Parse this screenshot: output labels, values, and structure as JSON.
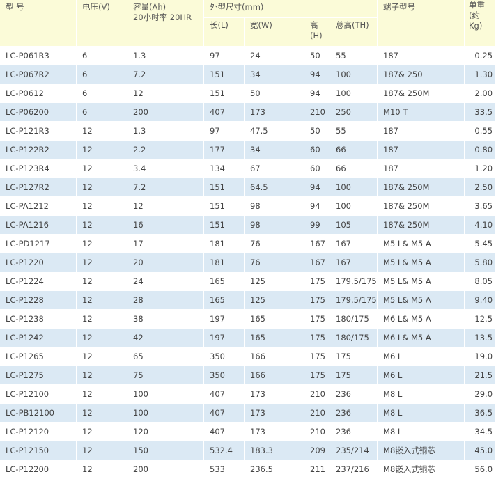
{
  "headers": {
    "model": "型  号",
    "voltage": "电压(V)",
    "capacity": "容量(Ah)",
    "capacity_sub": "20小时率 20HR",
    "dimensions": "外型尺寸(mm)",
    "length": "长(L)",
    "width": "宽(W)",
    "height_line1": "高",
    "height_line2": "(H)",
    "total_height": "总高(TH)",
    "terminal": "端子型号",
    "weight_line1": "单重",
    "weight_line2": "(约",
    "weight_line3": "Kg)"
  },
  "rows": [
    {
      "model": "LC-P061R3",
      "voltage": "6",
      "capacity": "1.3",
      "length": "97",
      "width": "24",
      "height": "50",
      "total_height": "55",
      "terminal": "187",
      "weight": "0.25"
    },
    {
      "model": "LC-P067R2",
      "voltage": "6",
      "capacity": "7.2",
      "length": "151",
      "width": "34",
      "height": "94",
      "total_height": "100",
      "terminal": "187& 250",
      "weight": "1.30"
    },
    {
      "model": "LC-P0612",
      "voltage": "6",
      "capacity": "12",
      "length": "151",
      "width": "50",
      "height": "94",
      "total_height": "100",
      "terminal": "187& 250M",
      "weight": "2.00"
    },
    {
      "model": "LC-P06200",
      "voltage": "6",
      "capacity": "200",
      "length": "407",
      "width": "173",
      "height": "210",
      "total_height": "250",
      "terminal": "M10 T",
      "weight": "33.5"
    },
    {
      "model": "LC-P121R3",
      "voltage": "12",
      "capacity": "1.3",
      "length": "97",
      "width": "47.5",
      "height": "50",
      "total_height": "55",
      "terminal": "187",
      "weight": "0.55"
    },
    {
      "model": "LC-P122R2",
      "voltage": "12",
      "capacity": "2.2",
      "length": "177",
      "width": "34",
      "height": "60",
      "total_height": "66",
      "terminal": "187",
      "weight": "0.80"
    },
    {
      "model": "LC-P123R4",
      "voltage": "12",
      "capacity": "3.4",
      "length": "134",
      "width": "67",
      "height": "60",
      "total_height": "66",
      "terminal": "187",
      "weight": "1.20"
    },
    {
      "model": "LC-P127R2",
      "voltage": "12",
      "capacity": "7.2",
      "length": "151",
      "width": "64.5",
      "height": "94",
      "total_height": "100",
      "terminal": "187& 250M",
      "weight": "2.50"
    },
    {
      "model": "LC-PA1212",
      "voltage": "12",
      "capacity": "12",
      "length": "151",
      "width": "98",
      "height": "94",
      "total_height": "100",
      "terminal": "187& 250M",
      "weight": "3.65"
    },
    {
      "model": "LC-PA1216",
      "voltage": "12",
      "capacity": "16",
      "length": "151",
      "width": "98",
      "height": "99",
      "total_height": "105",
      "terminal": "187& 250M",
      "weight": "4.10"
    },
    {
      "model": "LC-PD1217",
      "voltage": "12",
      "capacity": "17",
      "length": "181",
      "width": "76",
      "height": "167",
      "total_height": "167",
      "terminal": "M5 L& M5 A",
      "weight": "5.45"
    },
    {
      "model": "LC-P1220",
      "voltage": "12",
      "capacity": "20",
      "length": "181",
      "width": "76",
      "height": "167",
      "total_height": "167",
      "terminal": "M5 L& M5 A",
      "weight": "5.80"
    },
    {
      "model": "LC-P1224",
      "voltage": "12",
      "capacity": "24",
      "length": "165",
      "width": "125",
      "height": "175",
      "total_height": "179.5/175",
      "terminal": "M5 L& M5 A",
      "weight": "8.05"
    },
    {
      "model": "LC-P1228",
      "voltage": "12",
      "capacity": "28",
      "length": "165",
      "width": "125",
      "height": "175",
      "total_height": "179.5/175",
      "terminal": "M5 L& M5 A",
      "weight": "9.40"
    },
    {
      "model": "LC-P1238",
      "voltage": "12",
      "capacity": "38",
      "length": "197",
      "width": "165",
      "height": "175",
      "total_height": "180/175",
      "terminal": "M6 L& M5 A",
      "weight": "12.5"
    },
    {
      "model": "LC-P1242",
      "voltage": "12",
      "capacity": "42",
      "length": "197",
      "width": "165",
      "height": "175",
      "total_height": "180/175",
      "terminal": "M6 L& M5 A",
      "weight": "13.5"
    },
    {
      "model": "LC-P1265",
      "voltage": "12",
      "capacity": "65",
      "length": "350",
      "width": "166",
      "height": "175",
      "total_height": "175",
      "terminal": "M6 L",
      "weight": "19.0"
    },
    {
      "model": "LC-P1275",
      "voltage": "12",
      "capacity": "75",
      "length": "350",
      "width": "166",
      "height": "175",
      "total_height": "175",
      "terminal": "M6 L",
      "weight": "21.5"
    },
    {
      "model": "LC-P12100",
      "voltage": "12",
      "capacity": "100",
      "length": "407",
      "width": "173",
      "height": "210",
      "total_height": "236",
      "terminal": "M8 L",
      "weight": "29.0"
    },
    {
      "model": "LC-PB12100",
      "voltage": "12",
      "capacity": "100",
      "length": "407",
      "width": "173",
      "height": "210",
      "total_height": "236",
      "terminal": "M8 L",
      "weight": "36.5"
    },
    {
      "model": "LC-P12120",
      "voltage": "12",
      "capacity": "120",
      "length": "407",
      "width": "173",
      "height": "210",
      "total_height": "236",
      "terminal": "M8 L",
      "weight": "34.5"
    },
    {
      "model": "LC-P12150",
      "voltage": "12",
      "capacity": "150",
      "length": "532.4",
      "width": "183.3",
      "height": "209",
      "total_height": "235/214",
      "terminal": "M8嵌入式铜芯",
      "weight": "45.0"
    },
    {
      "model": "LC-P12200",
      "voltage": "12",
      "capacity": "200",
      "length": "533",
      "width": "236.5",
      "height": "211",
      "total_height": "237/216",
      "terminal": "M8嵌入式铜芯",
      "weight": "56.0"
    }
  ],
  "colors": {
    "header_bg": "#fbfbd8",
    "row_odd_bg": "#ffffff",
    "row_even_bg": "#dbe9f4",
    "text": "#444444"
  }
}
